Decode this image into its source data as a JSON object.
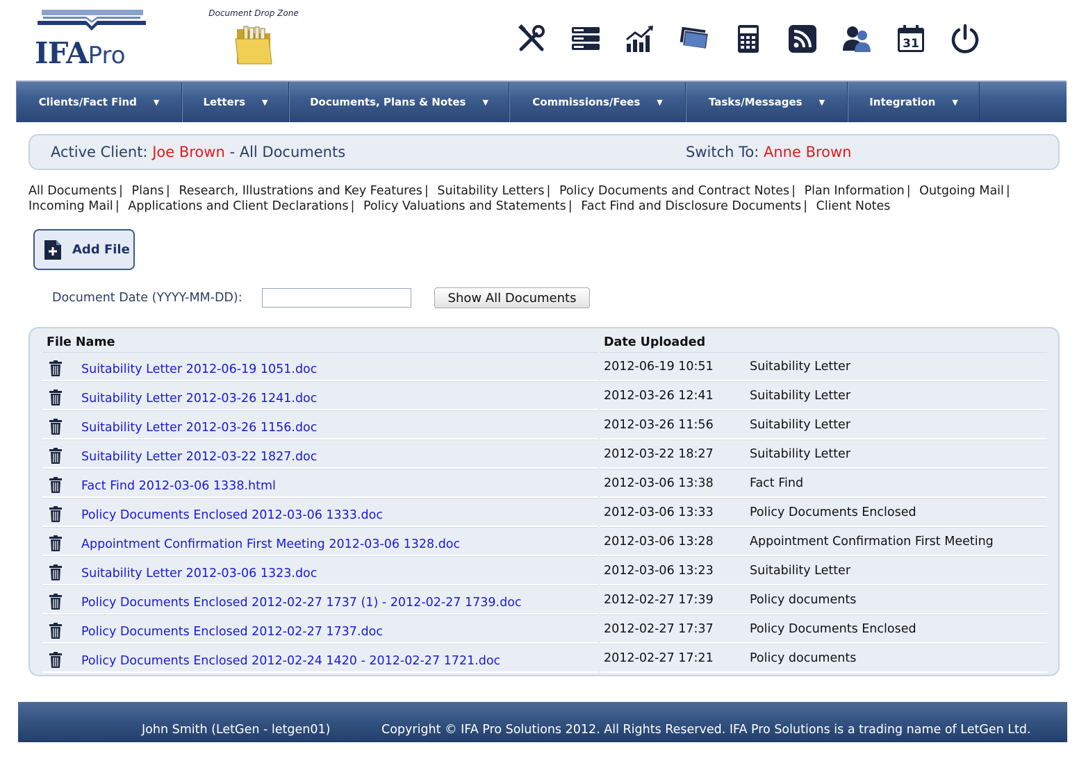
{
  "brand": {
    "logo_main": "IFA",
    "logo_sub": "Pro"
  },
  "dropzone": {
    "label": "Document Drop Zone"
  },
  "toolbar": [
    {
      "name": "tools-icon"
    },
    {
      "name": "server-icon"
    },
    {
      "name": "chart-icon"
    },
    {
      "name": "money-icon"
    },
    {
      "name": "calculator-icon"
    },
    {
      "name": "rss-icon"
    },
    {
      "name": "users-icon"
    },
    {
      "name": "calendar-icon",
      "text": "31"
    },
    {
      "name": "power-icon"
    }
  ],
  "nav": [
    {
      "label": "Clients/Fact Find"
    },
    {
      "label": "Letters"
    },
    {
      "label": "Documents, Plans & Notes"
    },
    {
      "label": "Commissions/Fees"
    },
    {
      "label": "Tasks/Messages"
    },
    {
      "label": "Integration"
    }
  ],
  "client_bar": {
    "active_label": "Active Client:",
    "active_name": "Joe Brown",
    "active_suffix": "- All Documents",
    "switch_label": "Switch To:",
    "switch_name": "Anne Brown"
  },
  "categories": [
    "All Documents",
    "Plans",
    "Research, Illustrations and Key Features",
    "Suitability Letters",
    "Policy Documents and Contract Notes",
    "Plan Information",
    "Outgoing Mail",
    "Incoming Mail",
    "Applications and Client Declarations",
    "Policy Valuations and Statements",
    "Fact Find and Disclosure Documents",
    "Client Notes"
  ],
  "add_file": {
    "label": "Add File"
  },
  "date_filter": {
    "label": "Document Date (YYYY-MM-DD):",
    "value": "",
    "button": "Show All Documents"
  },
  "table": {
    "col_file": "File Name",
    "col_date": "Date Uploaded",
    "rows": [
      {
        "file": "Suitability Letter 2012-06-19 1051.doc",
        "date": "2012-06-19 10:51",
        "type": "Suitability Letter"
      },
      {
        "file": "Suitability Letter 2012-03-26 1241.doc",
        "date": "2012-03-26 12:41",
        "type": "Suitability Letter"
      },
      {
        "file": "Suitability Letter 2012-03-26 1156.doc",
        "date": "2012-03-26 11:56",
        "type": "Suitability Letter"
      },
      {
        "file": "Suitability Letter 2012-03-22 1827.doc",
        "date": "2012-03-22 18:27",
        "type": "Suitability Letter"
      },
      {
        "file": "Fact Find 2012-03-06 1338.html",
        "date": "2012-03-06 13:38",
        "type": "Fact Find"
      },
      {
        "file": "Policy Documents Enclosed 2012-03-06 1333.doc",
        "date": "2012-03-06 13:33",
        "type": "Policy Documents Enclosed"
      },
      {
        "file": "Appointment Confirmation First Meeting 2012-03-06 1328.doc",
        "date": "2012-03-06 13:28",
        "type": "Appointment Confirmation First Meeting"
      },
      {
        "file": "Suitability Letter 2012-03-06 1323.doc",
        "date": "2012-03-06 13:23",
        "type": "Suitability Letter"
      },
      {
        "file": "Policy Documents Enclosed 2012-02-27 1737 (1) - 2012-02-27 1739.doc",
        "date": "2012-02-27 17:39",
        "type": "Policy documents"
      },
      {
        "file": "Policy Documents Enclosed 2012-02-27 1737.doc",
        "date": "2012-02-27 17:37",
        "type": "Policy Documents Enclosed"
      },
      {
        "file": "Policy Documents Enclosed 2012-02-24 1420 - 2012-02-27 1721.doc",
        "date": "2012-02-27 17:21",
        "type": "Policy documents"
      }
    ]
  },
  "footer": {
    "user": "John Smith (LetGen - letgen01)",
    "copyright": "Copyright © IFA Pro Solutions 2012. All Rights Reserved. IFA Pro Solutions is a trading name of LetGen Ltd."
  },
  "colors": {
    "nav": "#3d5d8f",
    "accent_red": "#e01b1b",
    "link_blue": "#1a1ad6",
    "panel": "#e9eef5"
  }
}
